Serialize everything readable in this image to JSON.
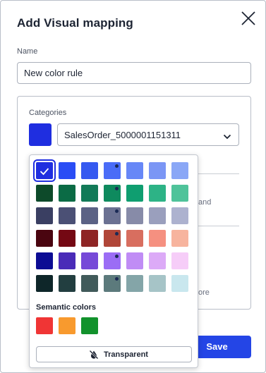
{
  "dialog": {
    "title": "Add Visual mapping",
    "close_icon": "close-icon"
  },
  "name_field": {
    "label": "Name",
    "value": "New color rule"
  },
  "categories": {
    "label": "Categories",
    "selected_color": "#1f2ee0",
    "selected_value": "SalesOrder_5000001151311",
    "chevron_icon": "chevron-down-icon"
  },
  "background_fragments": {
    "text_and": "and",
    "text_ore": "ore"
  },
  "footer": {
    "save_label": "Save"
  },
  "color_picker": {
    "palette": [
      [
        "#1f2ee0",
        "#2a4df5",
        "#3559f0",
        "#4a6cf7",
        "#6787f7",
        "#7b96f5",
        "#8aa7f6"
      ],
      [
        "#0d4a2a",
        "#0b6b45",
        "#127a58",
        "#0e8a5e",
        "#0f9e70",
        "#2db386",
        "#4fc39a"
      ],
      [
        "#3a3f62",
        "#4b5075",
        "#5b6285",
        "#6b7192",
        "#878ba8",
        "#9a9fbd",
        "#adb2cf"
      ],
      [
        "#4a0510",
        "#740813",
        "#8e2525",
        "#b04638",
        "#d86e5f",
        "#f59080",
        "#f7b49e"
      ],
      [
        "#0c0c94",
        "#4a2bb8",
        "#7649d8",
        "#9b6df5",
        "#c08cf5",
        "#dcaaf7",
        "#f6cdf8"
      ],
      [
        "#0e2629",
        "#223e40",
        "#415a5a",
        "#5c7a7c",
        "#84a5a8",
        "#a6c4c7",
        "#c9e7ee"
      ]
    ],
    "selected": [
      0,
      0
    ],
    "dotted": [
      [
        0,
        3
      ],
      [
        1,
        3
      ],
      [
        2,
        3
      ],
      [
        3,
        3
      ],
      [
        4,
        3
      ],
      [
        5,
        3
      ]
    ],
    "check_icon": "checkmark-icon",
    "semantic_label": "Semantic colors",
    "semantic_colors": [
      "#f03535",
      "#f89a2e",
      "#12922c"
    ],
    "transparent_label": "Transparent",
    "transparent_icon": "no-fill-icon"
  }
}
